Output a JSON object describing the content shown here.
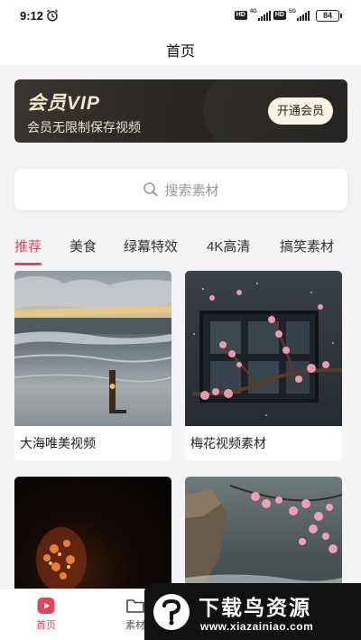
{
  "status_bar": {
    "time": "9:12",
    "hd1": "HD",
    "net1": "4G",
    "hd2": "HD",
    "net2": "5G",
    "battery": "84"
  },
  "header": {
    "title": "首页"
  },
  "vip_banner": {
    "title": "会员VIP",
    "subtitle": "会员无限制保存视频",
    "button_label": "开通会员"
  },
  "search": {
    "placeholder": "搜索素材"
  },
  "tabs": [
    {
      "label": "推荐",
      "active": true
    },
    {
      "label": "美食"
    },
    {
      "label": "绿幕特效"
    },
    {
      "label": "4K高清"
    },
    {
      "label": "搞笑素材"
    }
  ],
  "cards": [
    {
      "title": "大海唯美视频"
    },
    {
      "title": "梅花视频素材"
    },
    {
      "title": ""
    },
    {
      "title": ""
    }
  ],
  "bottom_nav": [
    {
      "label": "首页",
      "icon": "play-icon",
      "active": true
    },
    {
      "label": "素材",
      "icon": "folder-icon"
    }
  ],
  "watermark": {
    "title": "下载鸟资源",
    "url": "www.xiazainiao.com"
  },
  "colors": {
    "accent": "#e0475e",
    "vip_gold": "#f5e7c8",
    "vip_bg": "#2a2724"
  }
}
